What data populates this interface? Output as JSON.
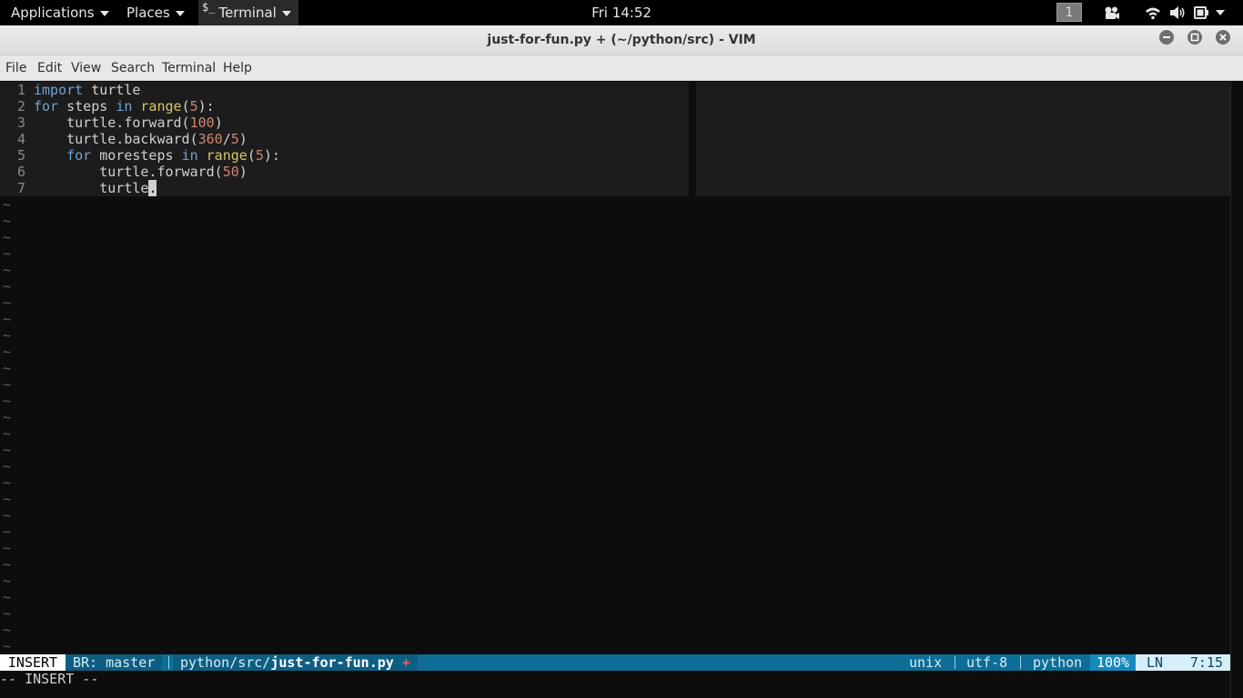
{
  "topbar": {
    "applications": "Applications",
    "places": "Places",
    "terminal_glyph": "$_",
    "terminal": "Terminal",
    "clock": "Fri 14:52",
    "workspace": "1"
  },
  "window": {
    "title": "just-for-fun.py + (~/python/src) - VIM"
  },
  "menubar": [
    "File",
    "Edit",
    "View",
    "Search",
    "Terminal",
    "Help"
  ],
  "editor": {
    "line_numbers": [
      "1",
      "2",
      "3",
      "4",
      "5",
      "6",
      "7"
    ],
    "lines": [
      [
        {
          "t": "import",
          "c": "kw"
        },
        {
          "t": " turtle",
          "c": ""
        }
      ],
      [
        {
          "t": "for",
          "c": "kw"
        },
        {
          "t": " steps ",
          "c": ""
        },
        {
          "t": "in",
          "c": "kw"
        },
        {
          "t": " ",
          "c": ""
        },
        {
          "t": "range",
          "c": "fn"
        },
        {
          "t": "(",
          "c": ""
        },
        {
          "t": "5",
          "c": "num"
        },
        {
          "t": "):",
          "c": ""
        }
      ],
      [
        {
          "t": "    turtle.forward(",
          "c": ""
        },
        {
          "t": "100",
          "c": "num"
        },
        {
          "t": ")",
          "c": ""
        }
      ],
      [
        {
          "t": "    turtle.backward(",
          "c": ""
        },
        {
          "t": "360",
          "c": "num"
        },
        {
          "t": "/",
          "c": ""
        },
        {
          "t": "5",
          "c": "num"
        },
        {
          "t": ")",
          "c": ""
        }
      ],
      [
        {
          "t": "    ",
          "c": ""
        },
        {
          "t": "for",
          "c": "kw"
        },
        {
          "t": " moresteps ",
          "c": ""
        },
        {
          "t": "in",
          "c": "kw"
        },
        {
          "t": " ",
          "c": ""
        },
        {
          "t": "range",
          "c": "fn"
        },
        {
          "t": "(",
          "c": ""
        },
        {
          "t": "5",
          "c": "num"
        },
        {
          "t": "):",
          "c": ""
        }
      ],
      [
        {
          "t": "        turtle.forward(",
          "c": ""
        },
        {
          "t": "50",
          "c": "num"
        },
        {
          "t": ")",
          "c": ""
        }
      ],
      [
        {
          "t": "        turtle",
          "c": ""
        },
        {
          "t": ".",
          "c": "cursor"
        }
      ]
    ],
    "empty_line_marker": "~"
  },
  "statusline": {
    "mode": "INSERT",
    "branch": "BR: master",
    "path_dir": "python/src/",
    "path_file": "just-for-fun.py",
    "modified": "+",
    "fileformat": "unix",
    "encoding": "utf-8",
    "filetype": "python",
    "percent": "100%",
    "ln_label": "LN",
    "position": "7:15"
  },
  "cmdline": "-- INSERT --",
  "colors": {
    "keyword": "#6fa3d6",
    "builtin": "#d7c66a",
    "number": "#d08770",
    "statusline_bg": "#0e6d96"
  }
}
